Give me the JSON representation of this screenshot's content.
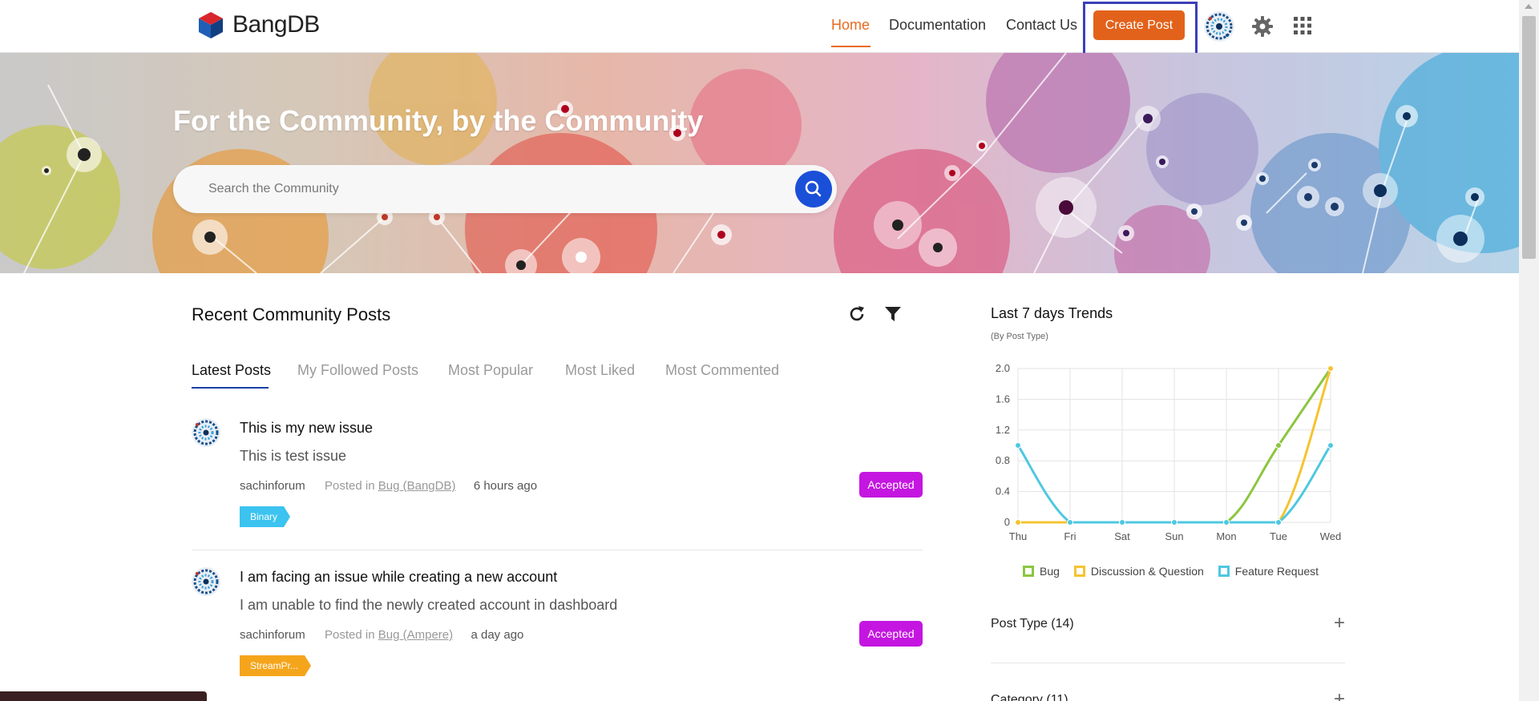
{
  "header": {
    "brand": "BangDB",
    "nav": [
      "Home",
      "Documentation",
      "Contact Us"
    ],
    "create_label": "Create Post"
  },
  "hero": {
    "title": "For the Community, by the Community",
    "search_placeholder": "Search the Community"
  },
  "posts_section": {
    "title": "Recent Community Posts",
    "tabs": [
      "Latest Posts",
      "My Followed Posts",
      "Most Popular",
      "Most Liked",
      "Most Commented"
    ],
    "active_tab": "Latest Posts",
    "posts": [
      {
        "title": "This is my new issue",
        "body": "This is test issue",
        "author": "sachinforum",
        "posted_in_label": "Posted in",
        "category": "Bug (BangDB)",
        "time": "6 hours ago",
        "status": "Accepted",
        "tag": "Binary",
        "tag_color": "#3cc3f0"
      },
      {
        "title": "I am facing an issue while creating a new account",
        "body": "I am unable to find the newly created account in dashboard",
        "author": "sachinforum",
        "posted_in_label": "Posted in",
        "category": "Bug (Ampere)",
        "time": "a day ago",
        "status": "Accepted",
        "tag": "StreamPr...",
        "tag_color": "#f5a51c"
      }
    ]
  },
  "trends": {
    "title": "Last 7 days Trends",
    "subtitle": "(By Post Type)"
  },
  "chart_data": {
    "type": "line",
    "categories": [
      "Thu",
      "Fri",
      "Sat",
      "Sun",
      "Mon",
      "Tue",
      "Wed"
    ],
    "ylim": [
      0,
      2.0
    ],
    "yticks": [
      "0",
      "0.4",
      "0.8",
      "1.2",
      "1.6",
      "2.0"
    ],
    "series": [
      {
        "name": "Bug",
        "color": "#8cc63f",
        "values": [
          0,
          0,
          0,
          0,
          0,
          1,
          2
        ]
      },
      {
        "name": "Discussion & Question",
        "color": "#f4c430",
        "values": [
          0,
          0,
          0,
          0,
          0,
          0,
          2
        ]
      },
      {
        "name": "Feature Request",
        "color": "#4fc8e0",
        "values": [
          1,
          0,
          0,
          0,
          0,
          0,
          1
        ]
      }
    ],
    "grid": true,
    "legend": "bottom"
  },
  "accordions": [
    {
      "label": "Post Type (14)"
    },
    {
      "label": "Category (11)"
    }
  ],
  "colors": {
    "accent": "#e2621b",
    "status": "#c416e0",
    "search": "#1a4fd8"
  }
}
